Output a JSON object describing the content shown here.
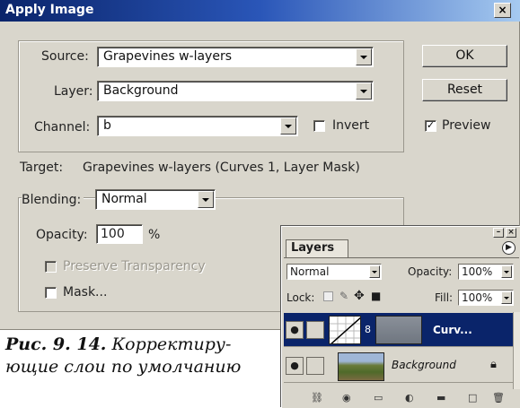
{
  "dialog": {
    "title": "Apply Image",
    "close_glyph": "×",
    "source_label": "Source:",
    "source_value": "Grapevines w-layers",
    "layer_label": "Layer:",
    "layer_value": "Background",
    "channel_label": "Channel:",
    "channel_value": "b",
    "invert_label": "Invert",
    "invert_checked": false,
    "target_label": "Target:",
    "target_value": "Grapevines w-layers (Curves 1, Layer Mask)",
    "blending_label": "Blending:",
    "blending_value": "Normal",
    "opacity_label": "Opacity:",
    "opacity_value": "100",
    "opacity_unit": "%",
    "preserve_label": "Preserve Transparency",
    "preserve_enabled": false,
    "mask_label": "Mask...",
    "mask_checked": false,
    "ok_label": "OK",
    "reset_label": "Reset",
    "preview_label": "Preview",
    "preview_checked": true,
    "check_glyph": "✓"
  },
  "layers_panel": {
    "tab_label": "Layers",
    "blend_mode": "Normal",
    "opacity_label": "Opacity:",
    "opacity_value": "100%",
    "lock_label": "Lock:",
    "fill_label": "Fill:",
    "fill_value": "100%",
    "layers": [
      {
        "name": "Curv...",
        "active": true
      },
      {
        "name": "Background",
        "active": false
      }
    ],
    "colors": {
      "active_row": "#0a246a",
      "panel_bg": "#d9d6cc"
    }
  },
  "caption": {
    "prefix": "Рис. 9. 14.",
    "text": "Корректиру-ющие слои по умолчанию"
  }
}
